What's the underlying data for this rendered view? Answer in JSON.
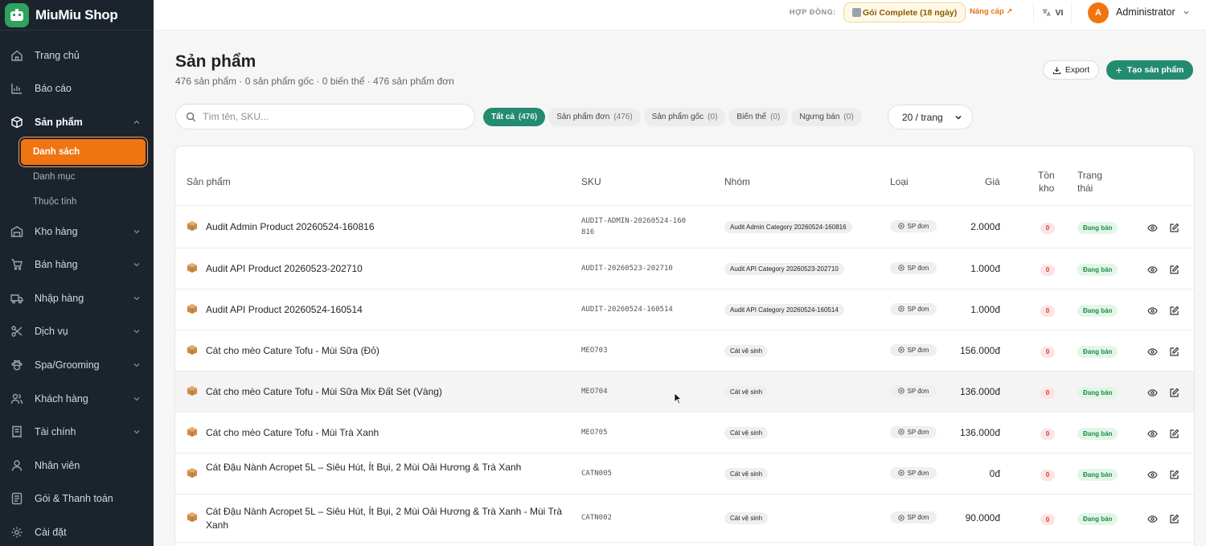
{
  "brand": {
    "name": "MiuMiu Shop"
  },
  "sidebar": {
    "items": [
      {
        "label": "Trang chủ",
        "icon": "home-icon"
      },
      {
        "label": "Báo cáo",
        "icon": "chart-icon"
      },
      {
        "label": "Sản phẩm",
        "icon": "box-icon",
        "active": true,
        "expanded": true
      },
      {
        "label": "Kho hàng",
        "icon": "warehouse-icon"
      },
      {
        "label": "Bán hàng",
        "icon": "cart-icon"
      },
      {
        "label": "Nhập hàng",
        "icon": "truck-icon"
      },
      {
        "label": "Dịch vụ",
        "icon": "scissors-icon"
      },
      {
        "label": "Spa/Grooming",
        "icon": "paw-icon"
      },
      {
        "label": "Khách hàng",
        "icon": "users-icon"
      },
      {
        "label": "Tài chính",
        "icon": "receipt-icon"
      },
      {
        "label": "Nhân viên",
        "icon": "user-icon"
      },
      {
        "label": "Gói & Thanh toán",
        "icon": "card-icon"
      },
      {
        "label": "Cài đặt",
        "icon": "gear-icon"
      }
    ],
    "sub_items": [
      "Danh sách",
      "Danh mục",
      "Thuộc tính"
    ]
  },
  "topbar": {
    "contract_label": "HỢP ĐỒNG:",
    "plan": "Gói Complete (18 ngày)",
    "upgrade": "Nâng cấp ↗",
    "lang": "VI",
    "avatar_letter": "A",
    "user": "Administrator"
  },
  "page": {
    "title": "Sản phẩm",
    "subtitle": "476 sản phẩm · 0 sản phẩm gốc · 0 biến thể · 476 sản phẩm đơn",
    "export_label": "Export",
    "create_label": "Tạo sản phẩm",
    "search_placeholder": "Tìm tên, SKU...",
    "per_page": "20 / trang"
  },
  "filters": [
    {
      "label": "Tất cả",
      "count": "(476)"
    },
    {
      "label": "Sản phẩm đơn",
      "count": "(476)"
    },
    {
      "label": "Sản phẩm gốc",
      "count": "(0)"
    },
    {
      "label": "Biến thể",
      "count": "(0)"
    },
    {
      "label": "Ngưng bán",
      "count": "(0)"
    }
  ],
  "table": {
    "headers": {
      "product": "Sản phẩm",
      "sku": "SKU",
      "group": "Nhóm",
      "type": "Loại",
      "price": "Giá",
      "stock_1": "Tồn",
      "stock_2": "kho",
      "status_1": "Trạng",
      "status_2": "thái"
    },
    "rows": [
      {
        "name": "Audit Admin Product 20260524-160816",
        "sku": "AUDIT-ADMIN-20260524-160816",
        "group": "Audit Admin Category 20260524-160816",
        "type": "SP đơn",
        "price": "2.000đ",
        "stock": "0",
        "status": "Đang bán"
      },
      {
        "name": "Audit API Product 20260523-202710",
        "sku": "AUDIT-20260523-202710",
        "group": "Audit API Category 20260523-202710",
        "type": "SP đơn",
        "price": "1.000đ",
        "stock": "0",
        "status": "Đang bán"
      },
      {
        "name": "Audit API Product 20260524-160514",
        "sku": "AUDIT-20260524-160514",
        "group": "Audit API Category 20260524-160514",
        "type": "SP đơn",
        "price": "1.000đ",
        "stock": "0",
        "status": "Đang bán"
      },
      {
        "name": "Cát cho mèo Cature Tofu - Mùi Sữa (Đỏ)",
        "sku": "MEO703",
        "group": "Cát vệ sinh",
        "type": "SP đơn",
        "price": "156.000đ",
        "stock": "0",
        "status": "Đang bán"
      },
      {
        "name": "Cát cho mèo Cature Tofu - Mùi Sữa Mix Đất Sét (Vàng)",
        "sku": "MEO704",
        "group": "Cát vệ sinh",
        "type": "SP đơn",
        "price": "136.000đ",
        "stock": "0",
        "status": "Đang bán"
      },
      {
        "name": "Cát cho mèo Cature Tofu - Mùi Trà Xanh",
        "sku": "MEO705",
        "group": "Cát vệ sinh",
        "type": "SP đơn",
        "price": "136.000đ",
        "stock": "0",
        "status": "Đang bán"
      },
      {
        "name": "Cát Đậu Nành Acropet 5L – Siêu Hút, Ít Bụi, 2 Mùi Oải Hương & Trà Xanh",
        "sku": "CATN005",
        "group": "Cát vệ sinh",
        "type": "SP đơn",
        "price": "0đ",
        "stock": "0",
        "status": "Đang bán"
      },
      {
        "name": "Cát Đậu Nành Acropet 5L – Siêu Hút, Ít Bụi, 2 Mùi Oải Hương & Trà Xanh - Mùi Trà Xanh",
        "sku": "CATN002",
        "group": "Cát vệ sinh",
        "type": "SP đơn",
        "price": "90.000đ",
        "stock": "0",
        "status": "Đang bán"
      }
    ]
  },
  "colors": {
    "accent": "#238b6f",
    "sidebar": "#1b242c",
    "active_sub": "#f07511"
  }
}
